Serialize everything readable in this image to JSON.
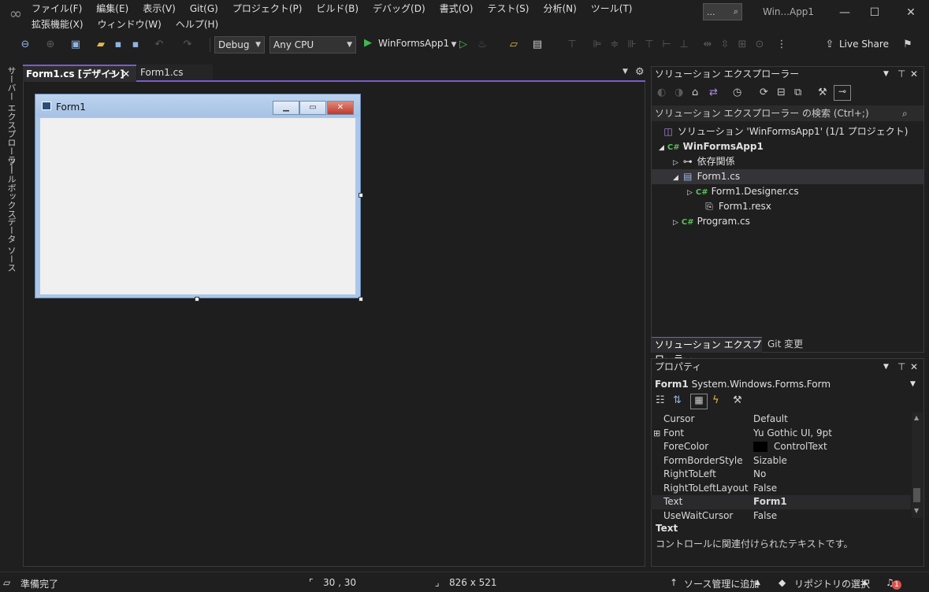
{
  "menu": {
    "items": [
      "ファイル(F)",
      "編集(E)",
      "表示(V)",
      "Git(G)",
      "プロジェクト(P)",
      "ビルド(B)",
      "デバッグ(D)",
      "書式(O)",
      "テスト(S)",
      "分析(N)",
      "ツール(T)",
      "拡張機能(X)",
      "ウィンドウ(W)",
      "ヘルプ(H)"
    ]
  },
  "title": {
    "search_label": "...",
    "app_title": "Win...App1"
  },
  "toolbar": {
    "config": "Debug",
    "platform": "Any CPU",
    "run_target": "WinFormsApp1",
    "live_share": "Live Share"
  },
  "left_strip": {
    "tabs": [
      "サーバー エクスプローラー",
      "ツールボックス",
      "データ ソース"
    ]
  },
  "editor": {
    "tabs": [
      "Form1.cs [デザイン]",
      "Form1.cs"
    ]
  },
  "form_designer": {
    "form_title": "Form1"
  },
  "solution_explorer": {
    "header": "ソリューション エクスプローラー",
    "search_placeholder": "ソリューション エクスプローラー の検索 (Ctrl+;)",
    "tree": [
      {
        "label": "ソリューション 'WinFormsApp1' (1/1 プロジェクト)",
        "icon": "solution-icon"
      },
      {
        "label": "WinFormsApp1",
        "icon": "csharp-project-icon"
      },
      {
        "label": "依存関係",
        "icon": "dependencies-icon"
      },
      {
        "label": "Form1.cs",
        "icon": "form-file-icon"
      },
      {
        "label": "Form1.Designer.cs",
        "icon": "csharp-file-icon"
      },
      {
        "label": "Form1.resx",
        "icon": "resource-file-icon"
      },
      {
        "label": "Program.cs",
        "icon": "csharp-file-icon"
      }
    ],
    "bottom_tabs": [
      "ソリューション エクスプローラー",
      "Git 変更"
    ]
  },
  "properties": {
    "header": "プロパティ",
    "object_name": "Form1",
    "object_type": "System.Windows.Forms.Form",
    "rows": [
      {
        "name": "Cursor",
        "value": "Default"
      },
      {
        "name": "Font",
        "value": "Yu Gothic UI, 9pt"
      },
      {
        "name": "ForeColor",
        "value": "ControlText"
      },
      {
        "name": "FormBorderStyle",
        "value": "Sizable"
      },
      {
        "name": "RightToLeft",
        "value": "No"
      },
      {
        "name": "RightToLeftLayout",
        "value": "False"
      },
      {
        "name": "Text",
        "value": "Form1"
      },
      {
        "name": "UseWaitCursor",
        "value": "False"
      }
    ],
    "description_title": "Text",
    "description_text": "コントロールに関連付けられたテキストです。"
  },
  "status": {
    "ready": "準備完了",
    "position": "30 , 30",
    "size": "826 x 521",
    "source_control": "ソース管理に追加",
    "repository": "リポジトリの選択",
    "notifications": "1"
  },
  "colors": {
    "accent": "#7a5ad6",
    "run_green": "#3fb950",
    "background": "#1f1f1f"
  }
}
